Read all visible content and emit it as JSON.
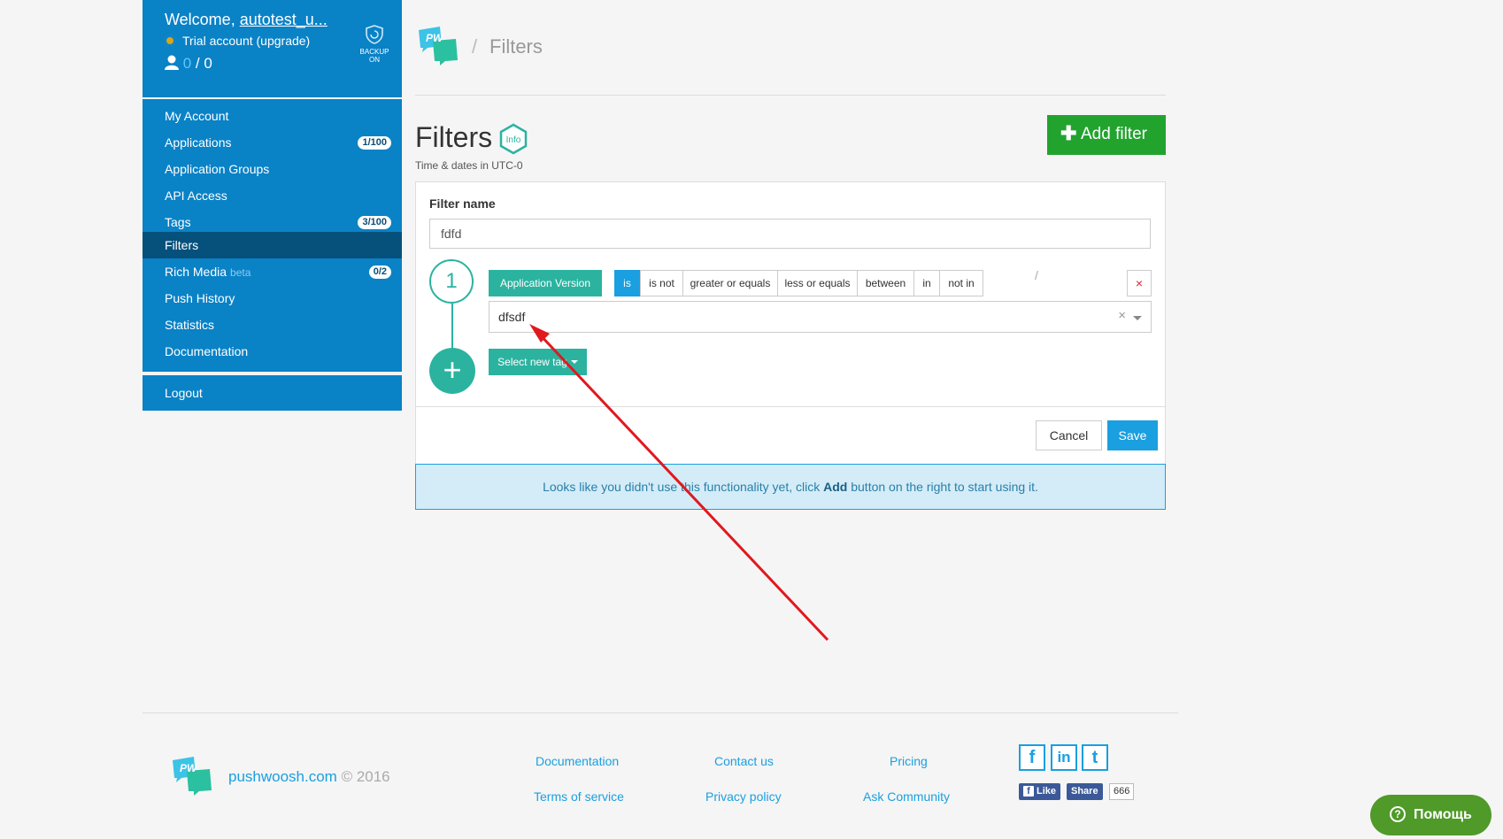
{
  "sidebar": {
    "welcome_prefix": "Welcome, ",
    "username": "autotest_u...",
    "trial": "Trial account (upgrade)",
    "users_active": "0",
    "users_total": " / 0",
    "backup_line1": "BACKUP",
    "backup_line2": "ON",
    "items": [
      {
        "label": "My Account",
        "badge": ""
      },
      {
        "label": "Applications",
        "badge": "1/100"
      },
      {
        "label": "Application Groups",
        "badge": ""
      },
      {
        "label": "API Access",
        "badge": ""
      },
      {
        "label": "Tags",
        "badge": "3/100"
      },
      {
        "label": "Filters",
        "badge": "",
        "active": true
      },
      {
        "label": "Rich Media",
        "suffix": "beta",
        "badge": "0/2"
      },
      {
        "label": "Push History",
        "badge": ""
      },
      {
        "label": "Statistics",
        "badge": ""
      },
      {
        "label": "Documentation",
        "badge": ""
      }
    ],
    "logout": "Logout"
  },
  "header": {
    "logo_text": "PW",
    "breadcrumb_sep": "/",
    "breadcrumb": "Filters"
  },
  "page": {
    "title": "Filters",
    "info_label": "Info",
    "subtitle": "Time & dates in UTC-0",
    "add_filter_label": "Add filter"
  },
  "form": {
    "filter_name_label": "Filter name",
    "filter_name_value": "fdfd",
    "step_number": "1",
    "tag_button": "Application Version",
    "slash": "/",
    "operators": [
      "is",
      "is not",
      "greater or equals",
      "less or equals",
      "between",
      "in",
      "not in"
    ],
    "active_operator": "is",
    "remove_symbol": "×",
    "value": "dfsdf",
    "clear_symbol": "×",
    "add_symbol": "+",
    "select_new_tag": "Select new tag",
    "cancel": "Cancel",
    "save": "Save"
  },
  "alert": {
    "before": "Looks like you didn't use this functionality yet, click ",
    "bold": "Add",
    "after": " button on the right to start using it."
  },
  "footer": {
    "brand": "pushwoosh.com",
    "copyright": " © 2016",
    "links": [
      "Documentation",
      "Contact us",
      "Pricing",
      "Terms of service",
      "Privacy policy",
      "Ask Community"
    ],
    "social": [
      "f",
      "in",
      "t"
    ],
    "fb_like": "Like",
    "fb_share": "Share",
    "fb_count": "666"
  },
  "help": {
    "label": "Помощь",
    "icon": "?"
  },
  "annotation": {
    "arrow_color": "#e0191f"
  },
  "colors": {
    "sidebar": "#0a82c6",
    "active": "#06507c",
    "teal": "#2bb3a0",
    "green": "#22a32e",
    "blue": "#1a9fe0"
  }
}
